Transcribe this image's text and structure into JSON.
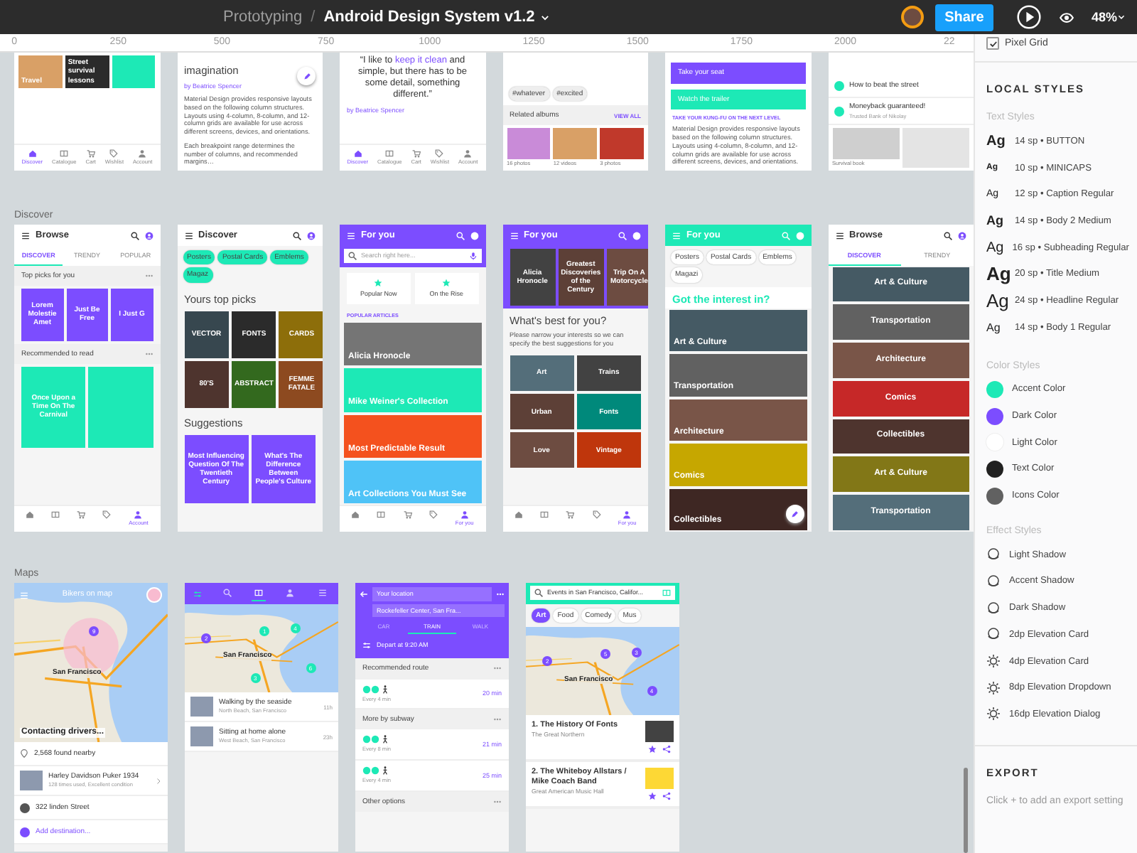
{
  "topbar": {
    "project": "Prototyping",
    "separator": "/",
    "file": "Android Design System v1.2",
    "share": "Share",
    "zoom": "48%"
  },
  "ruler": [
    "0",
    "250",
    "500",
    "750",
    "1000",
    "1250",
    "1500",
    "1750",
    "2000",
    "22"
  ],
  "canvas": {
    "sections": [
      {
        "frames": [
          {
            "blocks": [
              {
                "kind": "photos",
                "items": [
                  {
                    "label": "Travel",
                    "color": "#d9a066"
                  },
                  {
                    "label": "Street survival lessons",
                    "color": "#2b2b2b"
                  },
                  {
                    "color": "#1de9b6"
                  }
                ]
              },
              {
                "kind": "navbar",
                "items": [
                  {
                    "label": "Discover",
                    "selected": true
                  },
                  {
                    "label": "Catalogue",
                    "selected": false
                  },
                  {
                    "label": "Cart",
                    "selected": false
                  },
                  {
                    "label": "Wishlist",
                    "selected": false
                  },
                  {
                    "label": "Account",
                    "selected": false
                  }
                ]
              }
            ]
          },
          {
            "blocks": [
              {
                "kind": "heading",
                "text": "imagination"
              },
              {
                "kind": "byline",
                "text": "by Beatrice Spencer"
              },
              {
                "kind": "fab"
              },
              {
                "kind": "text",
                "text": "Material Design provides responsive layouts based on the following column structures. Layouts using 4-column, 8-column, and 12-column grids are available for use across different screens, devices, and orientations."
              },
              {
                "kind": "text",
                "text": "Each breakpoint range determines the number of columns, and recommended margins…"
              }
            ]
          },
          {
            "blocks": [
              {
                "kind": "quote",
                "before": "“I like to ",
                "highlight": "keep it clean",
                "after": " and simple, but there has to be some detail, something different.”"
              },
              {
                "kind": "byline",
                "text": "by Beatrice Spencer"
              },
              {
                "kind": "navbar",
                "items": [
                  {
                    "label": "Discover",
                    "selected": true
                  },
                  {
                    "label": "Catalogue",
                    "selected": false
                  },
                  {
                    "label": "Cart",
                    "selected": false
                  },
                  {
                    "label": "Wishlist",
                    "selected": false
                  },
                  {
                    "label": "Account",
                    "selected": false
                  }
                ]
              }
            ]
          },
          {
            "blocks": [
              {
                "kind": "chips-tags",
                "items": [
                  {
                    "label": "#whatever",
                    "selected": false
                  },
                  {
                    "label": "#excited",
                    "selected": false
                  }
                ]
              },
              {
                "kind": "sectionhead",
                "title": "Related albums",
                "action": "VIEW ALL"
              },
              {
                "kind": "photos",
                "items": [
                  {
                    "sub": "16 photos",
                    "color": "#c98bd8"
                  },
                  {
                    "sub": "12 videos",
                    "color": "#d9a066"
                  },
                  {
                    "sub": "3 photos",
                    "color": "#c0392b"
                  }
                ]
              }
            ]
          },
          {
            "blocks": [
              {
                "kind": "buttons",
                "items": [
                  {
                    "label": "Take your seat",
                    "color": "#7c4dff"
                  },
                  {
                    "label": "Watch the trailer",
                    "color": "#1de9b6"
                  }
                ]
              },
              {
                "kind": "small",
                "text": "TAKE YOUR KUNG-FU ON THE NEXT LEVEL"
              },
              {
                "kind": "text",
                "text": "Material Design provides responsive layouts based on the following column structures. Layouts using 4-column, 8-column, and 12-column grids are available for use across different screens, devices, and orientations."
              }
            ]
          },
          {
            "blocks": [
              {
                "kind": "listrows",
                "items": [
                  {
                    "kind": "dot",
                    "title": "How to beat the street"
                  },
                  {
                    "kind": "dot",
                    "title": "Moneyback guaranteed!",
                    "sub": "Trusted Bank of Nikolay"
                  }
                ]
              },
              {
                "kind": "photos",
                "items": [
                  {
                    "sub": "Survival book",
                    "color": "#cfcfcf"
                  },
                  {
                    "color": "#e4e4e4"
                  }
                ]
              }
            ]
          }
        ]
      },
      {
        "label": "Discover",
        "frames": [
          {
            "blocks": [
              {
                "kind": "appbar",
                "title": "Browse",
                "color": "#ffffff"
              },
              {
                "kind": "tabs",
                "items": [
                  {
                    "label": "DISCOVER",
                    "selected": true
                  },
                  {
                    "label": "TRENDY",
                    "selected": false
                  },
                  {
                    "label": "POPULAR",
                    "selected": false
                  }
                ]
              },
              {
                "kind": "sectionhead",
                "title": "Top picks for you"
              },
              {
                "kind": "tiles-tall",
                "items": [
                  {
                    "label": "Lorem Molestie Amet",
                    "color": "#7c4dff"
                  },
                  {
                    "label": "Just Be Free",
                    "color": "#7c4dff"
                  },
                  {
                    "label": "I Just G",
                    "color": "#7c4dff"
                  }
                ]
              },
              {
                "kind": "sectionhead",
                "title": "Recommended to read"
              },
              {
                "kind": "tiles-tall",
                "items": [
                  {
                    "label": "Once Upon a Time On The Carnival",
                    "color": "#1de9b6"
                  },
                  {
                    "color": "#1de9b6"
                  }
                ]
              },
              {
                "kind": "navbar",
                "items": [
                  {
                    "selected": false
                  },
                  {
                    "selected": false
                  },
                  {
                    "selected": false
                  },
                  {
                    "selected": false
                  },
                  {
                    "label": "Account",
                    "selected": true
                  }
                ]
              }
            ]
          },
          {
            "blocks": [
              {
                "kind": "appbar",
                "title": "Discover",
                "color": "#ffffff"
              },
              {
                "kind": "chips-filled",
                "items": [
                  {
                    "label": "Posters",
                    "selected": false
                  },
                  {
                    "label": "Postal Cards",
                    "selected": false
                  },
                  {
                    "label": "Emblems",
                    "selected": false
                  },
                  {
                    "label": "Magaz",
                    "selected": false
                  }
                ]
              },
              {
                "kind": "heading",
                "text": "Yours top picks"
              },
              {
                "kind": "tiles-square",
                "items": [
                  {
                    "label": "VECTOR",
                    "color": "#37474f"
                  },
                  {
                    "label": "FONTS",
                    "color": "#2b2b2b"
                  },
                  {
                    "label": "CARDS",
                    "color": "#8d6e0a"
                  },
                  {
                    "label": "80'S",
                    "color": "#4e342e"
                  },
                  {
                    "label": "ABSTRACT",
                    "color": "#33691e"
                  },
                  {
                    "label": "FEMME FATALE",
                    "color": "#8d4a20"
                  }
                ]
              },
              {
                "kind": "heading",
                "text": "Suggestions"
              },
              {
                "kind": "tiles-square",
                "items": [
                  {
                    "label": "Most Influencing Question Of The Twentieth Century",
                    "color": "#7c4dff"
                  },
                  {
                    "label": "What's The Difference Between People's Culture",
                    "color": "#7c4dff"
                  }
                ]
              }
            ]
          },
          {
            "blocks": [
              {
                "kind": "appbar",
                "title": "For you",
                "color": "#7c4dff"
              },
              {
                "kind": "searchbar",
                "color": "#7c4dff",
                "placeholder": "Search right here..."
              },
              {
                "kind": "cards",
                "items": [
                  "Popular Now",
                  "On the Rise"
                ]
              },
              {
                "kind": "small",
                "text": "POPULAR ARTICLES"
              },
              {
                "kind": "banners",
                "items": [
                  {
                    "label": "Alicia Hronocle",
                    "color": "#757575"
                  },
                  {
                    "label": "Mike Weiner's Collection",
                    "color": "#1de9b6"
                  },
                  {
                    "label": "Most Predictable Result",
                    "color": "#f4511e"
                  },
                  {
                    "label": "Art Collections You Must See",
                    "color": "#4fc3f7"
                  }
                ]
              },
              {
                "kind": "navbar",
                "items": [
                  {
                    "selected": false
                  },
                  {
                    "selected": false
                  },
                  {
                    "selected": false
                  },
                  {
                    "selected": false
                  },
                  {
                    "label": "For you",
                    "selected": true
                  }
                ]
              }
            ]
          },
          {
            "blocks": [
              {
                "kind": "appbar",
                "title": "For you",
                "color": "#7c4dff"
              },
              {
                "kind": "tiles-band",
                "items": [
                  {
                    "label": "Alicia Hronocle",
                    "color": "#424242"
                  },
                  {
                    "label": "Greatest Discoveries of the Century",
                    "color": "#5d4037"
                  },
                  {
                    "label": "Trip On A Motorcycle",
                    "color": "#6d4c41"
                  }
                ]
              },
              {
                "kind": "heading",
                "text": "What's best for you?"
              },
              {
                "kind": "text",
                "text": "Please narrow your interests so we can specify the best suggestions for you"
              },
              {
                "kind": "tiles-wide",
                "items": [
                  {
                    "label": "Art",
                    "color": "#546e7a"
                  },
                  {
                    "label": "Trains",
                    "color": "#424242"
                  },
                  {
                    "label": "Urban",
                    "color": "#5d4037"
                  },
                  {
                    "label": "Fonts",
                    "color": "#00897b"
                  },
                  {
                    "label": "Love",
                    "color": "#6d4c41"
                  },
                  {
                    "label": "Vintage",
                    "color": "#bf360c"
                  }
                ]
              },
              {
                "kind": "navbar",
                "items": [
                  {
                    "selected": false
                  },
                  {
                    "selected": false
                  },
                  {
                    "selected": false
                  },
                  {
                    "selected": false
                  },
                  {
                    "label": "For you",
                    "selected": true
                  }
                ]
              }
            ]
          },
          {
            "blocks": [
              {
                "kind": "appbar",
                "title": "For you",
                "color": "#1de9b6"
              },
              {
                "kind": "chips",
                "items": [
                  {
                    "label": "Posters",
                    "selected": false
                  },
                  {
                    "label": "Postal Cards",
                    "selected": false
                  },
                  {
                    "label": "Emblems",
                    "selected": false
                  },
                  {
                    "label": "Magazi",
                    "selected": false
                  }
                ]
              },
              {
                "kind": "heading",
                "text": "Got the interest in?",
                "color": "#1de9b6"
              },
              {
                "kind": "banners",
                "items": [
                  {
                    "label": "Art & Culture",
                    "color": "#455a64"
                  },
                  {
                    "label": "Transportation",
                    "color": "#616161"
                  },
                  {
                    "label": "Architecture",
                    "color": "#795548"
                  },
                  {
                    "label": "Comics",
                    "color": "#c6a700"
                  },
                  {
                    "label": "Collectibles",
                    "color": "#3e2723"
                  }
                ]
              },
              {
                "kind": "fab"
              }
            ]
          },
          {
            "blocks": [
              {
                "kind": "appbar",
                "title": "Browse",
                "color": "#ffffff"
              },
              {
                "kind": "tabs",
                "items": [
                  {
                    "label": "DISCOVER",
                    "selected": true
                  },
                  {
                    "label": "TRENDY",
                    "selected": false
                  }
                ]
              },
              {
                "kind": "banners-centered",
                "items": [
                  {
                    "label": "Art & Culture",
                    "color": "#455a64"
                  },
                  {
                    "label": "Transportation",
                    "color": "#616161"
                  },
                  {
                    "label": "Architecture",
                    "color": "#795548"
                  },
                  {
                    "label": "Comics",
                    "color": "#c62828"
                  },
                  {
                    "label": "Collectibles",
                    "color": "#4e342e"
                  },
                  {
                    "label": "Art & Culture",
                    "color": "#827717"
                  },
                  {
                    "label": "Transportation",
                    "color": "#546e7a"
                  }
                ]
              }
            ]
          }
        ]
      },
      {
        "label": "Maps",
        "frames": [
          {
            "blocks": [
              {
                "kind": "map",
                "title": "Bikers on map",
                "city": "San Francisco",
                "caption": "Contacting drivers...",
                "avatar": true,
                "pins": [
                  {
                    "label": "9",
                    "color": "#7c4dff"
                  }
                ]
              },
              {
                "kind": "listrows",
                "items": [
                  {
                    "kind": "pin",
                    "title": "2,568 found nearby"
                  },
                  {
                    "kind": "thumb",
                    "title": "Harley Davidson Puker 1934",
                    "sub": "128 times used, Excellent condition"
                  },
                  {
                    "kind": "dot",
                    "title": "322 linden Street"
                  },
                  {
                    "kind": "add",
                    "title": "Add destination..."
                  }
                ]
              }
            ]
          },
          {
            "blocks": [
              {
                "kind": "icontabs",
                "color": "#7c4dff",
                "items": [
                  {
                    "selected": false
                  },
                  {
                    "selected": true
                  },
                  {
                    "selected": false
                  },
                  {
                    "selected": false
                  }
                ]
              },
              {
                "kind": "map",
                "city": "San Francisco",
                "pins": [
                  {
                    "label": "1",
                    "color": "#1de9b6"
                  },
                  {
                    "label": "2",
                    "color": "#7c4dff"
                  },
                  {
                    "label": "4",
                    "color": "#1de9b6"
                  },
                  {
                    "label": "6",
                    "color": "#1de9b6"
                  },
                  {
                    "label": "3",
                    "color": "#1de9b6"
                  }
                ]
              },
              {
                "kind": "listrows",
                "items": [
                  {
                    "kind": "thumb",
                    "title": "Walking by the seaside",
                    "sub": "North Beach, San Francisco",
                    "meta": "11h"
                  },
                  {
                    "kind": "thumb",
                    "title": "Sitting at home alone",
                    "sub": "West Beach, San Francisco",
                    "meta": "23h"
                  }
                ]
              }
            ]
          },
          {
            "blocks": [
              {
                "kind": "routehead",
                "color": "#7c4dff",
                "from": "Your location",
                "to": "Rockefeller Center, San Fra...",
                "modes": [
                  {
                    "label": "CAR",
                    "selected": false
                  },
                  {
                    "label": "TRAIN",
                    "selected": true
                  },
                  {
                    "label": "WALK",
                    "selected": false
                  }
                ],
                "depart": "Depart at 9:20 AM"
              },
              {
                "kind": "sectionhead",
                "title": "Recommended route"
              },
              {
                "kind": "route",
                "time": "20 min",
                "sub": "Every 4 min"
              },
              {
                "kind": "sectionhead",
                "title": "More by subway"
              },
              {
                "kind": "route",
                "time": "21 min",
                "sub": "Every 8 min"
              },
              {
                "kind": "route",
                "time": "25 min",
                "sub": "Every 4 min"
              },
              {
                "kind": "sectionhead",
                "title": "Other options"
              }
            ]
          },
          {
            "blocks": [
              {
                "kind": "searchbar",
                "color": "#1de9b6",
                "value": "Events in San Francisco, Califor..."
              },
              {
                "kind": "chips",
                "items": [
                  {
                    "label": "Art",
                    "selected": true
                  },
                  {
                    "label": "Food",
                    "selected": false
                  },
                  {
                    "label": "Comedy",
                    "selected": false
                  },
                  {
                    "label": "Mus",
                    "selected": false
                  }
                ]
              },
              {
                "kind": "map",
                "city": "San Francisco",
                "pins": [
                  {
                    "label": "5",
                    "color": "#7c4dff"
                  },
                  {
                    "label": "2",
                    "color": "#7c4dff"
                  },
                  {
                    "label": "3",
                    "color": "#7c4dff"
                  },
                  {
                    "label": "4",
                    "color": "#7c4dff"
                  }
                ]
              },
              {
                "kind": "events",
                "items": [
                  {
                    "title": "1. The History Of Fonts",
                    "sub": "The Great Northern",
                    "color": "#424242"
                  },
                  {
                    "title": "2. The Whiteboy Allstars / Mike Coach Band",
                    "sub": "Great American Music Hall",
                    "color": "#fdd835"
                  }
                ]
              }
            ]
          }
        ]
      }
    ]
  },
  "panel": {
    "pixel_grid": {
      "label": "Pixel Grid",
      "checked": true
    },
    "title": "LOCAL STYLES",
    "text_styles": {
      "heading": "Text Styles",
      "items": [
        {
          "sample": "Ag",
          "label": "14 sp • BUTTON",
          "kind": "button"
        },
        {
          "sample": "Ag",
          "label": "10 sp • MINICAPS",
          "kind": "minicaps"
        },
        {
          "sample": "Ag",
          "label": "12 sp • Caption Regular",
          "kind": "caption"
        },
        {
          "sample": "Ag",
          "label": "14 sp • Body 2 Medium",
          "kind": "body2"
        },
        {
          "sample": "Ag",
          "label": "16 sp • Subheading Regular",
          "kind": "subheading"
        },
        {
          "sample": "Ag",
          "label": "20 sp • Title Medium",
          "kind": "title"
        },
        {
          "sample": "Ag",
          "label": "24 sp • Headline Regular",
          "kind": "headline"
        },
        {
          "sample": "Ag",
          "label": "14 sp • Body 1 Regular",
          "kind": "body1"
        }
      ]
    },
    "color_styles": {
      "heading": "Color Styles",
      "items": [
        {
          "label": "Accent Color",
          "color": "#1de9b6"
        },
        {
          "label": "Dark Color",
          "color": "#7c4dff"
        },
        {
          "label": "Light Color",
          "color": "#ffffff"
        },
        {
          "label": "Text Color",
          "color": "#212121"
        },
        {
          "label": "Icons Color",
          "color": "#616161"
        }
      ]
    },
    "effect_styles": {
      "heading": "Effect Styles",
      "items": [
        {
          "label": "Light Shadow",
          "kind": "shadow"
        },
        {
          "label": "Accent Shadow",
          "kind": "shadow"
        },
        {
          "label": "Dark Shadow",
          "kind": "shadow"
        },
        {
          "label": "2dp Elevation Card",
          "kind": "shadow"
        },
        {
          "label": "4dp Elevation Card",
          "kind": "elevation"
        },
        {
          "label": "8dp Elevation Dropdown",
          "kind": "elevation"
        },
        {
          "label": "16dp Elevation Dialog",
          "kind": "elevation"
        }
      ]
    },
    "export": {
      "title": "EXPORT",
      "hint": "Click + to add an export setting"
    }
  }
}
